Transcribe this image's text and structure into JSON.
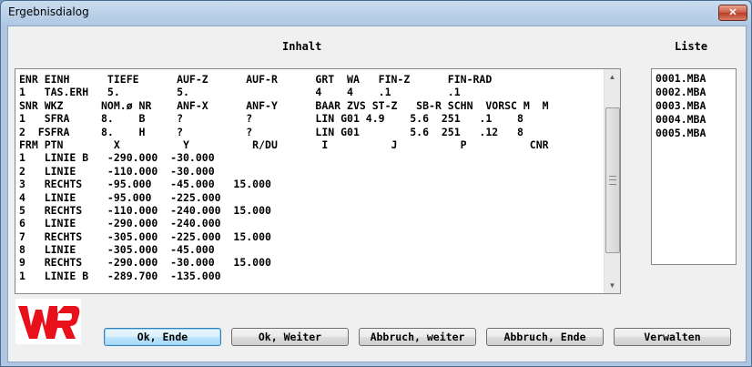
{
  "window": {
    "title": "Ergebnisdialog",
    "close_label": "✕"
  },
  "labels": {
    "inhalt": "Inhalt",
    "liste": "Liste"
  },
  "content": {
    "lines": [
      "ENR EINH      TIEFE      AUF-Z      AUF-R      GRT  WA   FIN-Z      FIN-RAD",
      "1   TAS.ERH   5.         5.                    4    4    .1         .1",
      "SNR WKZ      NOM.ø NR    ANF-X      ANF-Y      BAAR ZVS ST-Z   SB-R SCHN  VORSC M  M",
      "1   SFRA     8.    B     ?          ?          LIN G01 4.9    5.6  251   .1    8",
      "2  FSFRA     8.    H     ?          ?          LIN G01        5.6  251   .12   8",
      "FRM PTN        X          Y          R/DU       I          J          P          CNR",
      "1   LINIE B   -290.000  -30.000",
      "2   LINIE     -110.000  -30.000",
      "3   RECHTS    -95.000   -45.000   15.000",
      "4   LINIE     -95.000   -225.000",
      "5   RECHTS    -110.000  -240.000  15.000",
      "6   LINIE     -290.000  -240.000",
      "7   RECHTS    -305.000  -225.000  15.000",
      "8   LINIE     -305.000  -45.000",
      "9   RECHTS    -290.000  -30.000   15.000",
      "1   LINIE B   -289.700  -135.000"
    ]
  },
  "liste": {
    "items": [
      "0001.MBA",
      "0002.MBA",
      "0003.MBA",
      "0004.MBA",
      "0005.MBA"
    ]
  },
  "buttons": {
    "ok_ende": "Ok, Ende",
    "ok_weiter": "Ok, Weiter",
    "abbruch_weiter": "Abbruch, weiter",
    "abbruch_ende": "Abbruch, Ende",
    "verwalten": "Verwalten"
  },
  "colors": {
    "logo_red": "#e8101a",
    "default_button": "#3c7fb1"
  }
}
